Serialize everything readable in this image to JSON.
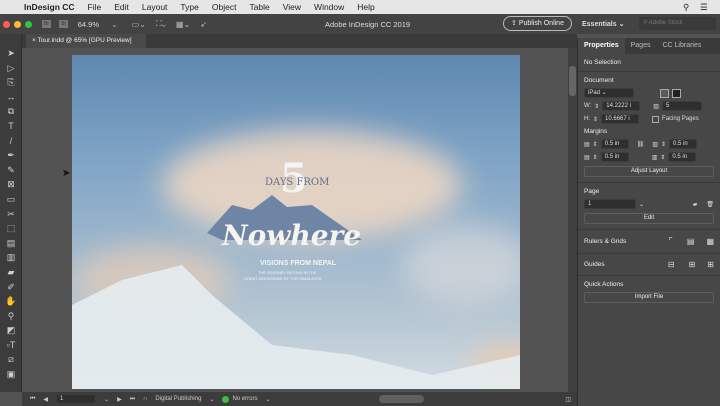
{
  "menubar": {
    "app": "InDesign CC",
    "items": [
      "File",
      "Edit",
      "Layout",
      "Type",
      "Object",
      "Table",
      "View",
      "Window",
      "Help"
    ]
  },
  "appbar": {
    "zoom": "64.9%",
    "title": "Adobe InDesign CC 2019",
    "publish": "Publish Online",
    "workspace": "Essentials",
    "search_placeholder": "Adobe Stock",
    "br": "Br",
    "st": "St"
  },
  "document_tab": "Tour.indd @ 65% [GPU Preview]",
  "artwork": {
    "number": "5",
    "days_from": "DAYS FROM",
    "title": "Nowhere",
    "subtitle": "VISIONS FROM NEPAL",
    "line1": "THE JOURNEY BEGINS IN THE",
    "line2": "GREAT MOUNTAINS OF THE HIMALAYAS"
  },
  "panel": {
    "tabs": [
      "Properties",
      "Pages",
      "CC Libraries"
    ],
    "selection": "No Selection",
    "document": {
      "heading": "Document",
      "preset": "iPad",
      "width_label": "W:",
      "width": "14.2222 i",
      "height_label": "H:",
      "height": "10.6667 i",
      "pages": "5",
      "facing": "Facing Pages"
    },
    "margins": {
      "heading": "Margins",
      "top": "0.5 in",
      "bottom": "0.5 in",
      "left": "0.5 in",
      "right": "0.5 in",
      "adjust": "Adjust Layout"
    },
    "page": {
      "heading": "Page",
      "value": "1",
      "edit": "Edit"
    },
    "rulers": "Rulers & Grids",
    "guides": "Guides",
    "quick": {
      "heading": "Quick Actions",
      "import": "Import File"
    }
  },
  "status": {
    "page": "1",
    "intent": "Digital Publishing",
    "preflight": "No errors",
    "preflight_color": "#3fbf3f"
  }
}
